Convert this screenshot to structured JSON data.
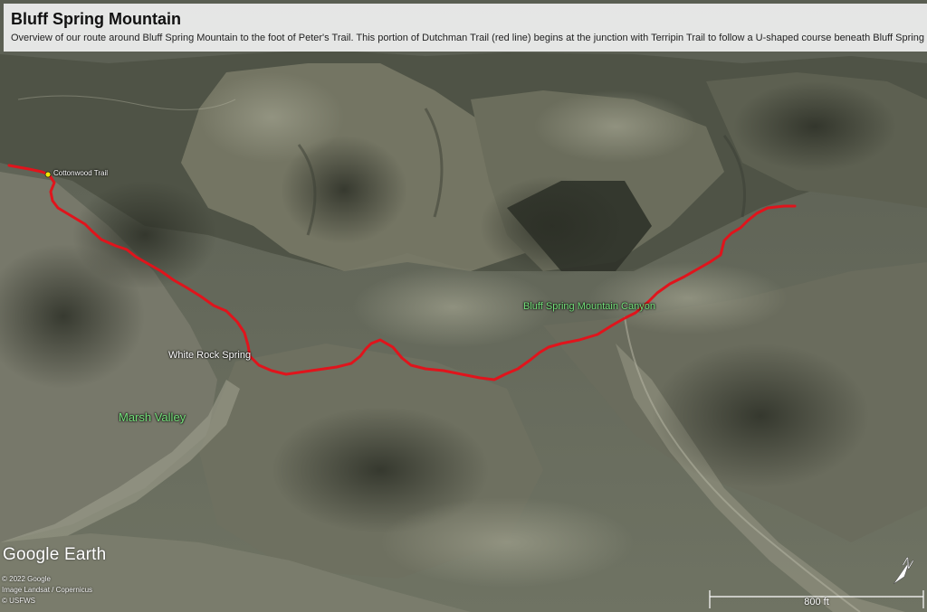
{
  "header": {
    "title": "Bluff Spring Mountain",
    "description": "Overview of our route around Bluff Spring Mountain to the foot of Peter's Trail. This portion of Dutchman Trail (red line) begins at the junction with Terripin Trail to follow a U-shaped course beneath Bluff Spring Mountai"
  },
  "labels": {
    "cottonwood_trail": "Cottonwood Trail",
    "white_rock_spring": "White Rock Spring",
    "marsh_valley": "Marsh Valley",
    "bluff_spring_mountain_canyon": "Bluff Spring Mountain Canyon"
  },
  "branding": {
    "logo": "Google Earth",
    "credits": [
      "© 2022 Google",
      "Image Landsat / Copernicus",
      "© USFWS"
    ]
  },
  "scale": {
    "label": "800 ft"
  },
  "compass": {
    "icon": "north-arrow-icon",
    "letter": "N"
  },
  "colors": {
    "route": "#e0141c",
    "label_green": "#74e07a",
    "header_bg": "#f0f0f0"
  }
}
